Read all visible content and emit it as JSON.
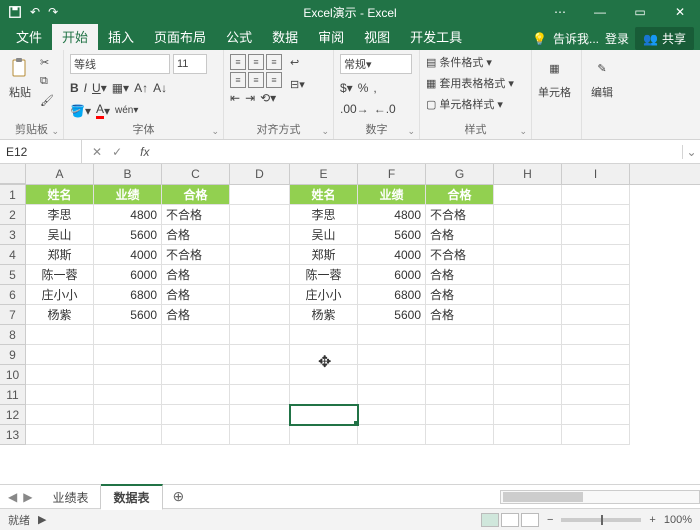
{
  "title": "Excel演示 - Excel",
  "tabs": {
    "file": "文件",
    "home": "开始",
    "insert": "插入",
    "layout": "页面布局",
    "formulas": "公式",
    "data": "数据",
    "review": "审阅",
    "view": "视图",
    "dev": "开发工具"
  },
  "tellme": "告诉我...",
  "signin": "登录",
  "share": "共享",
  "ribbon": {
    "clipboard": "剪贴板",
    "paste": "粘贴",
    "font": "字体",
    "fontname": "等线",
    "fontsize": "11",
    "alignment": "对齐方式",
    "wrap": "自动换行",
    "merge": "合并后居中",
    "number": "数字",
    "numfmt": "常规",
    "styles": "样式",
    "condfmt": "条件格式",
    "tblfmt": "套用表格格式",
    "cellstyle": "单元格样式",
    "cells": "单元格",
    "editing": "编辑"
  },
  "namebox": "E12",
  "cols": [
    "A",
    "B",
    "C",
    "D",
    "E",
    "F",
    "G",
    "H",
    "I"
  ],
  "header": {
    "name": "姓名",
    "score": "业绩",
    "pass": "合格"
  },
  "left": [
    {
      "name": "李思",
      "score": "4800",
      "pass": "不合格"
    },
    {
      "name": "吴山",
      "score": "5600",
      "pass": "合格"
    },
    {
      "name": "郑斯",
      "score": "4000",
      "pass": "不合格"
    },
    {
      "name": "陈一蓉",
      "score": "6000",
      "pass": "合格"
    },
    {
      "name": "庄小小",
      "score": "6800",
      "pass": "合格"
    },
    {
      "name": "杨紫",
      "score": "5600",
      "pass": "合格"
    }
  ],
  "right": [
    {
      "name": "李思",
      "score": "4800",
      "pass": "不合格"
    },
    {
      "name": "吴山",
      "score": "5600",
      "pass": "合格"
    },
    {
      "name": "郑斯",
      "score": "4000",
      "pass": "不合格"
    },
    {
      "name": "陈一蓉",
      "score": "6000",
      "pass": "合格"
    },
    {
      "name": "庄小小",
      "score": "6800",
      "pass": "合格"
    },
    {
      "name": "杨紫",
      "score": "5600",
      "pass": "合格"
    }
  ],
  "sheets": {
    "s1": "业绩表",
    "s2": "数据表"
  },
  "status": {
    "ready": "就绪",
    "zoom": "100%"
  }
}
